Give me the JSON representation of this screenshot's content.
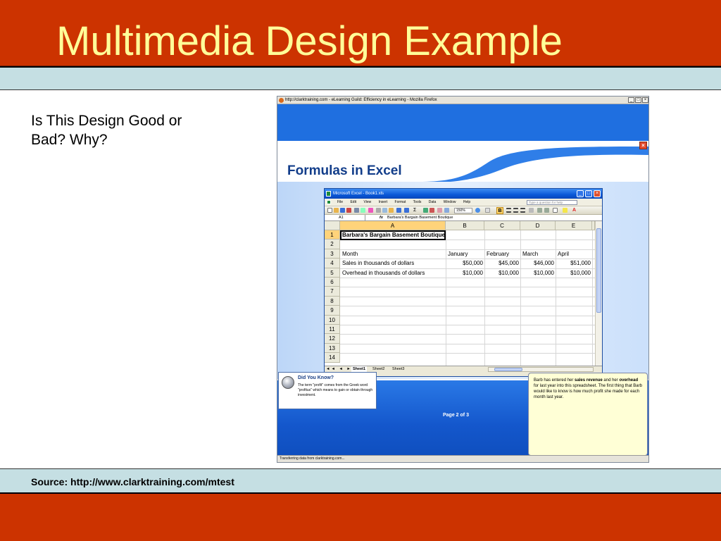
{
  "slide": {
    "title": "Multimedia Design Example",
    "question": "Is This Design Good or Bad? Why?",
    "source": "Source: http://www.clarktraining.com/mtest"
  },
  "browser": {
    "window_title": "http://clarktraining.com - eLearning Guild: Efficiency in eLearning - Mozilla Firefox",
    "status_text": "Transferring data from clarktraining.com...",
    "lesson_title": "Formulas in Excel",
    "page_indicator": "Page 2 of 3",
    "did_you_know": {
      "title": "Did You Know?",
      "text": "The term \"profit\" comes from the Greek word \"profitus\" which means to gain or obtain through investment."
    },
    "note": {
      "part1": "Barb has entered her ",
      "bold1": "sales revenue",
      "part2": " and her ",
      "bold2": "overhead",
      "part3": " for last year into this spreadsheet.  The first thing that Barb would like to know is how much profit she made for each month last year."
    }
  },
  "excel": {
    "window_title": "Microsoft Excel - Book1.xls",
    "menu": [
      "File",
      "Edit",
      "View",
      "Insert",
      "Format",
      "Tools",
      "Data",
      "Window",
      "Help"
    ],
    "help_placeholder": "Type a question for help",
    "zoom": "150%",
    "bold_label": "B",
    "name_box": "A1",
    "fx_label": "fx",
    "formula": "Barbara's Bargain Basement Boutique",
    "columns": [
      "A",
      "B",
      "C",
      "D",
      "E"
    ],
    "row_numbers": [
      "1",
      "2",
      "3",
      "4",
      "5",
      "6",
      "7",
      "8",
      "9",
      "10",
      "11",
      "12",
      "13",
      "14"
    ],
    "cells": {
      "a1": "Barbara's Bargain Basement Boutique",
      "r3": [
        "Month",
        "January",
        "February",
        "March",
        "April"
      ],
      "r4": [
        "Sales in thousands of dollars",
        "$50,000",
        "$45,000",
        "$46,000",
        "$51,000"
      ],
      "r5": [
        "Overhead in thousands of dollars",
        "$10,000",
        "$10,000",
        "$10,000",
        "$10,000"
      ]
    },
    "tab_nav": "◄◄ ◄ ► ►►",
    "sheets": [
      "Sheet1",
      "Sheet2",
      "Sheet3"
    ]
  },
  "colors": {
    "band_red": "#cc3300",
    "strip_blue": "#c5dfe3",
    "title_yellow": "#ffff99",
    "excel_blue": "#0a58d8",
    "note_yellow": "#ffffd6"
  }
}
